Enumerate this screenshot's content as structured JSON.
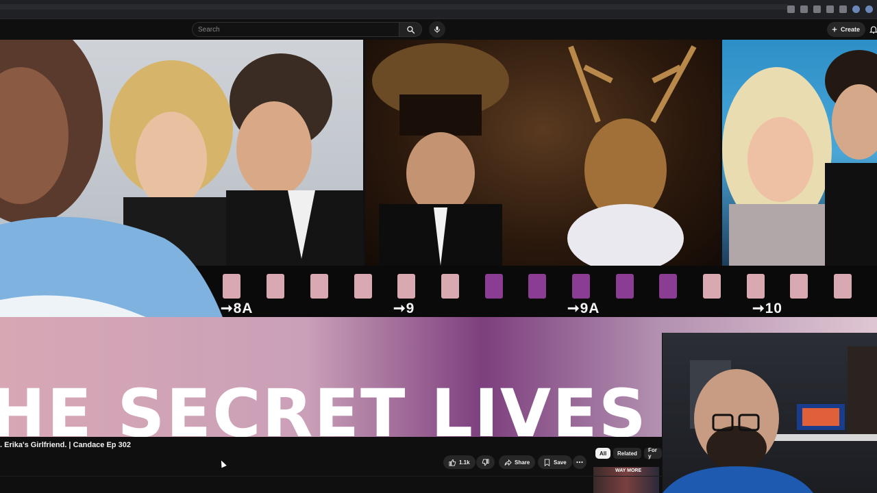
{
  "masthead": {
    "search_placeholder": "Search",
    "create_label": "Create"
  },
  "video": {
    "frame_labels": [
      "8A",
      "9",
      "9A",
      "10"
    ],
    "thumbnail_title": "HE SECRET LIVES"
  },
  "below_video": {
    "title": ". Erika's Girlfriend. | Candace Ep 302",
    "like_count": "1.1k",
    "share_label": "Share",
    "save_label": "Save",
    "chips": [
      "All",
      "Related",
      "For y"
    ],
    "related_thumb_text": "WAY MORE"
  },
  "colors": {
    "background": "#0f0f0f",
    "button_bg": "#272727",
    "film_hole_pink": "#d8a9b1",
    "film_hole_purple": "#8a3d93"
  }
}
